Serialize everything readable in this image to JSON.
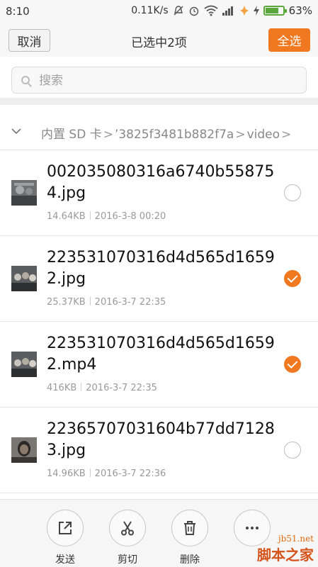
{
  "status_bar": {
    "time": "8:10",
    "speed": "0.11K/s",
    "battery": "63%"
  },
  "header": {
    "cancel_label": "取消",
    "title": "已选中2项",
    "select_all_label": "全选",
    "accent_color": "#f07820"
  },
  "search": {
    "placeholder": "搜索"
  },
  "breadcrumb": {
    "root": "内置 SD 卡",
    "folder": "’3825f3481b882f7a",
    "current": "video"
  },
  "files": [
    {
      "name": "002035080316a6740b558754.jpg",
      "size": "14.64KB",
      "date": "2016-3-8 00:20",
      "selected": false
    },
    {
      "name": "223531070316d4d565d16592.jpg",
      "size": "25.37KB",
      "date": "2016-3-7 22:35",
      "selected": true
    },
    {
      "name": "223531070316d4d565d16592.mp4",
      "size": "416KB",
      "date": "2016-3-7 22:35",
      "selected": true
    },
    {
      "name": "22365707031604b77dd71283.jpg",
      "size": "14.96KB",
      "date": "2016-3-7 22:36",
      "selected": false
    }
  ],
  "toolbar": {
    "send_label": "发送",
    "cut_label": "剪切",
    "delete_label": "删除"
  },
  "watermark": {
    "site": "jb51.net",
    "brand": "脚本之家"
  }
}
